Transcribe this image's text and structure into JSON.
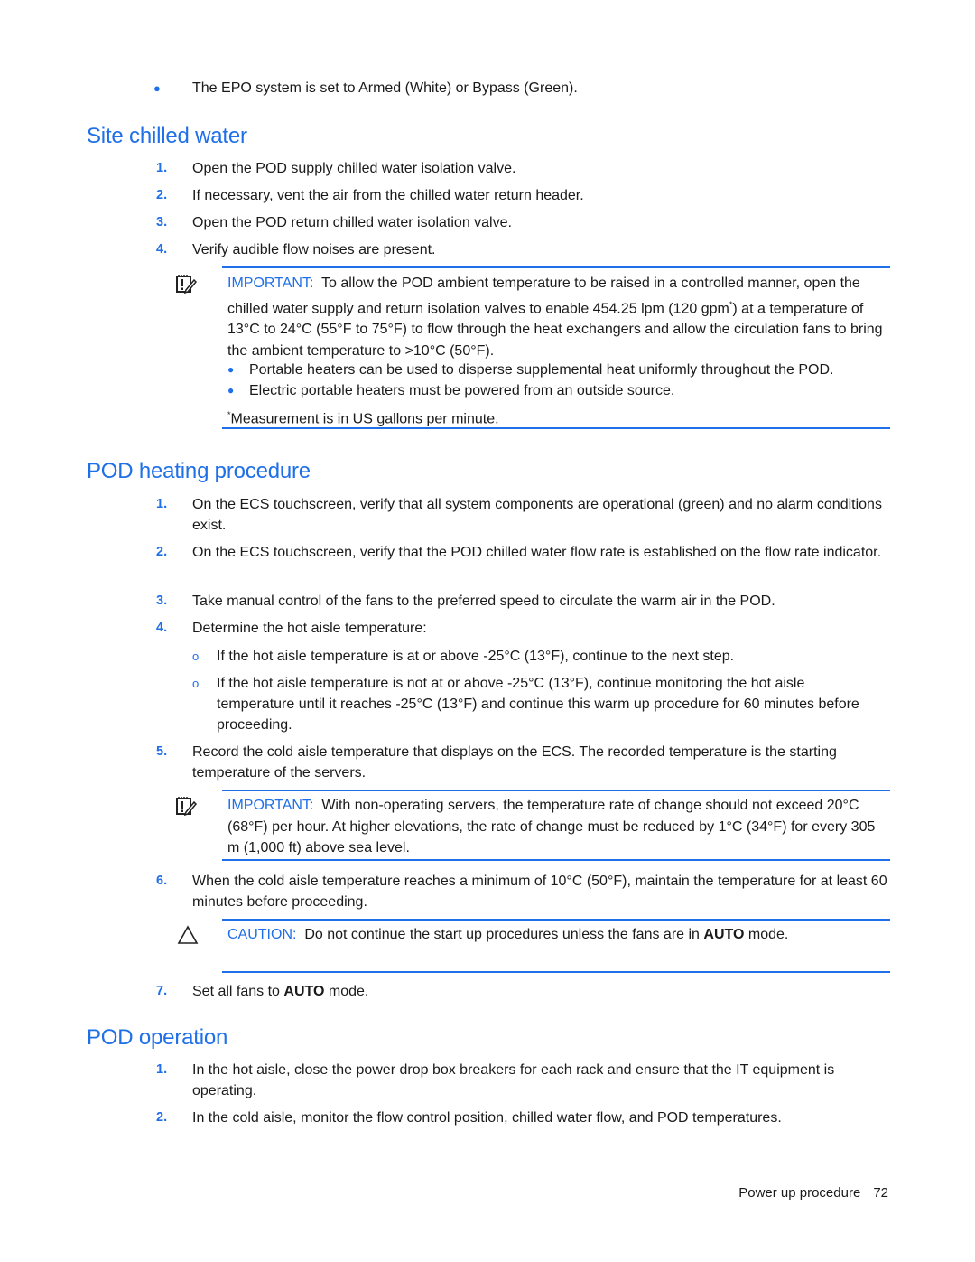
{
  "intro_bullet": "The EPO system is set to Armed (White) or Bypass (Green).",
  "sections": {
    "site_chilled_water": {
      "title": "Site chilled water",
      "steps": [
        {
          "num": "1.",
          "text": "Open the POD supply chilled water isolation valve."
        },
        {
          "num": "2.",
          "text": "If necessary, vent the air from the chilled water return header."
        },
        {
          "num": "3.",
          "text": "Open the POD return chilled water isolation valve."
        },
        {
          "num": "4.",
          "text": "Verify audible flow noises are present."
        }
      ],
      "note": {
        "icon": "important-note-icon",
        "label": "IMPORTANT:",
        "text": "To allow the POD ambient temperature to be raised in a controlled manner, open the chilled water supply and return isolation valves to enable 454.25 lpm (120 gpm",
        "sup": "*",
        "text_after": ") at a temperature of 13°C to 24°C (55°F to 75°F) to flow through the heat exchangers and allow the circulation fans to bring the ambient temperature to >10°C (50°F).",
        "bullets": [
          "Portable heaters can be used to disperse supplemental heat uniformly throughout the POD.",
          "Electric portable heaters must be powered from an outside source."
        ],
        "footnote_mark": "*",
        "footnote": "Measurement is in US gallons per minute."
      }
    },
    "pod_heating": {
      "title": "POD heating procedure",
      "steps": [
        {
          "num": "1.",
          "text": "On the ECS touchscreen, verify that all system components are operational (green) and no alarm conditions exist."
        },
        {
          "num": "2.",
          "text": "On the ECS touchscreen, verify that the POD chilled water flow rate is established on the flow rate indicator."
        },
        {
          "num": "3.",
          "text": "Take manual control of the fans to the preferred speed to circulate the warm air in the POD."
        },
        {
          "num": "4.",
          "text": "Determine the hot aisle temperature:"
        },
        {
          "num": "5.",
          "text": "Record the cold aisle temperature that displays on the ECS. The recorded temperature is the starting temperature of the servers."
        },
        {
          "num": "6.",
          "text": "When the cold aisle temperature reaches a minimum of 10°C (50°F), maintain the temperature for at least 60 minutes before proceeding."
        },
        {
          "num": "7.",
          "text_before": "Set all fans to ",
          "bold": "AUTO",
          "text_after": " mode."
        }
      ],
      "sub_bullets": [
        {
          "marker": "o",
          "text": "If the hot aisle temperature is at or above -25°C (13°F), continue to the next step."
        },
        {
          "marker": "o",
          "text": "If the hot aisle temperature is not at or above -25°C (13°F), continue monitoring the hot aisle temperature until it reaches -25°C (13°F) and continue this warm up procedure for 60 minutes before proceeding."
        }
      ],
      "important_note": {
        "icon": "important-note-icon",
        "label": "IMPORTANT:",
        "text": "With non-operating servers, the temperature rate of change should not exceed 20°C (68°F) per hour. At higher elevations, the rate of change must be reduced by 1°C (34°F) for every 305 m (1,000 ft) above sea level."
      },
      "caution_note": {
        "icon": "caution-triangle-icon",
        "label": "CAUTION:",
        "text_before": "Do not continue the start up procedures unless the fans are in ",
        "bold": "AUTO",
        "text_after": " mode."
      }
    },
    "pod_operation": {
      "title": "POD operation",
      "steps": [
        {
          "num": "1.",
          "text": "In the hot aisle, close the power drop box breakers for each rack and ensure that the IT equipment is operating."
        },
        {
          "num": "2.",
          "text": "In the cold aisle, monitor the flow control position, chilled water flow, and POD temperatures."
        }
      ]
    }
  },
  "footer": {
    "section": "Power up procedure",
    "page": "72"
  },
  "colors": {
    "accent": "#1e6fe8",
    "text": "#1a1a1a"
  }
}
